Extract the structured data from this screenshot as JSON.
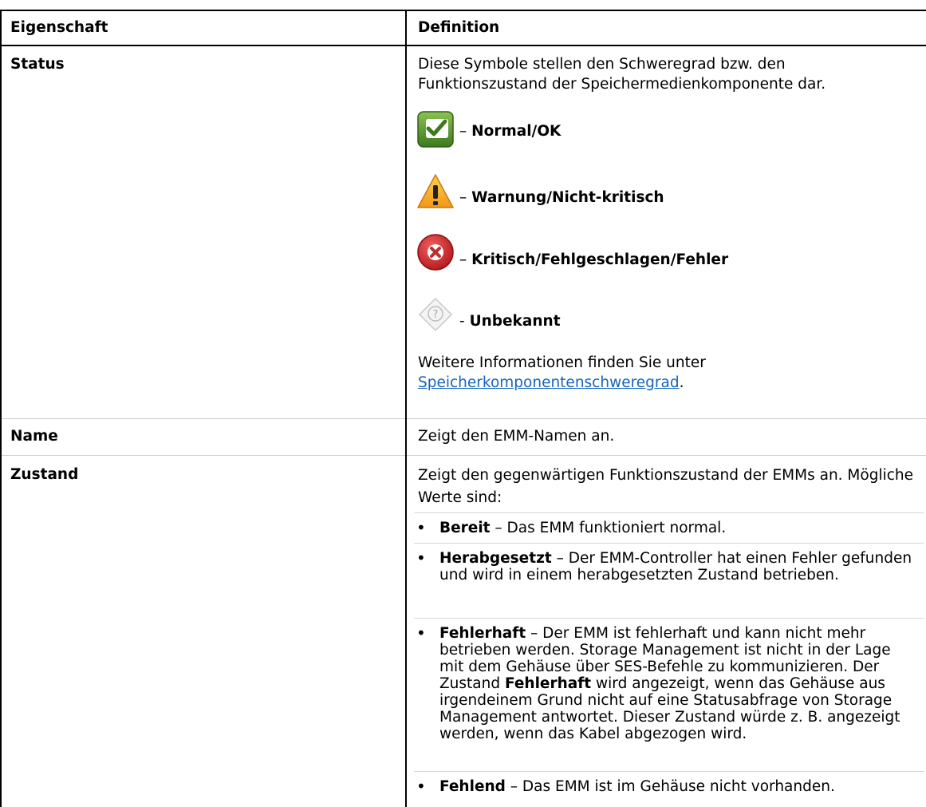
{
  "table": {
    "headers": {
      "property": "Eigenschaft",
      "definition": "Definition"
    },
    "status": {
      "property": "Status",
      "intro": "Diese Symbole stellen den Schweregrad bzw. den Funktionszustand der Speichermedienkomponente dar.",
      "icons": [
        {
          "icon": "check-icon",
          "dash": "–",
          "label": "Normal/OK"
        },
        {
          "icon": "warning-icon",
          "dash": "–",
          "label": "Warnung/Nicht-kritisch"
        },
        {
          "icon": "error-icon",
          "dash": "–",
          "label": "Kritisch/Fehlgeschlagen/Fehler"
        },
        {
          "icon": "unknown-icon",
          "dash": "-",
          "label": "Unbekannt"
        }
      ],
      "more_info_prefix": "Weitere Informationen finden Sie unter",
      "more_info_link": "Speicherkomponentenschweregrad",
      "more_info_suffix": "."
    },
    "name": {
      "property": "Name",
      "definition": "Zeigt den EMM-Namen an."
    },
    "zustand": {
      "property": "Zustand",
      "intro": "Zeigt den gegenwärtigen Funktionszustand der EMMs an. Mögliche Werte sind:",
      "items": [
        {
          "term": "Bereit",
          "text": " – Das EMM funktioniert normal."
        },
        {
          "term": "Herabgesetzt",
          "text": " – Der EMM-Controller hat einen Fehler gefunden und wird in einem herabgesetzten Zustand betrieben."
        },
        {
          "term": "Fehlerhaft",
          "text": " – Der EMM ist fehlerhaft und kann nicht mehr betrieben werden. Storage Management ist nicht in der Lage mit dem Gehäuse über SES-Befehle zu kommunizieren. Der Zustand ",
          "term2": "Fehlerhaft",
          "text2": " wird angezeigt, wenn das Gehäuse aus irgendeinem Grund nicht auf eine Statusabfrage von Storage Management antwortet. Dieser Zustand würde z. B. angezeigt werden, wenn das Kabel abgezogen wird."
        },
        {
          "term": "Fehlend",
          "text": " – Das EMM ist im Gehäuse nicht vorhanden."
        }
      ]
    }
  }
}
